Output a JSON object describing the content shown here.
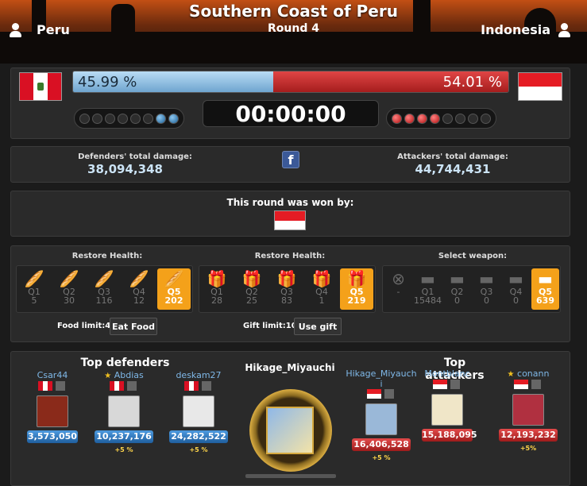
{
  "header": {
    "region": "Southern Coast of Peru",
    "round": "Round 4",
    "defender": "Peru",
    "attacker": "Indonesia"
  },
  "battle": {
    "def_percent": "45.99 %",
    "att_percent": "54.01 %",
    "def_fraction": 0.4599,
    "timer": "00:00:00",
    "def_dots": [
      0,
      0,
      0,
      0,
      0,
      0,
      1,
      1
    ],
    "att_dots": [
      1,
      1,
      1,
      1,
      0,
      0,
      0,
      0
    ]
  },
  "damage": {
    "def_label": "Defenders' total damage:",
    "def_value": "38,094,348",
    "att_label": "Attackers' total damage:",
    "att_value": "44,744,431",
    "facebook_icon": "facebook-icon"
  },
  "round_result": {
    "label": "This round was won by:",
    "winner_flag": "Indonesia"
  },
  "restore": {
    "food_title": "Restore Health:",
    "gift_title": "Restore Health:",
    "weapon_title": "Select weapon:",
    "food": [
      {
        "q": "Q1",
        "n": "5"
      },
      {
        "q": "Q2",
        "n": "30"
      },
      {
        "q": "Q3",
        "n": "116"
      },
      {
        "q": "Q4",
        "n": "12"
      },
      {
        "q": "Q5",
        "n": "202"
      }
    ],
    "gifts": [
      {
        "q": "Q1",
        "n": "28"
      },
      {
        "q": "Q2",
        "n": "25"
      },
      {
        "q": "Q3",
        "n": "83"
      },
      {
        "q": "Q4",
        "n": "1"
      },
      {
        "q": "Q5",
        "n": "219"
      }
    ],
    "weapons": [
      {
        "q": "",
        "n": "-"
      },
      {
        "q": "Q1",
        "n": "15484"
      },
      {
        "q": "Q2",
        "n": "0"
      },
      {
        "q": "Q3",
        "n": "0"
      },
      {
        "q": "Q4",
        "n": "0"
      },
      {
        "q": "Q5",
        "n": "639"
      }
    ],
    "food_limit": "Food limit:4",
    "eat_food": "Eat Food",
    "gift_limit": "Gift limit:10",
    "use_gift": "Use gift"
  },
  "top": {
    "def_title": "Top defenders",
    "att_title": "Top attackers",
    "center_name": "Hikage_Miyauchi",
    "center_damage": "16,406,528",
    "defenders": [
      {
        "name": "Csar44",
        "damage": "3,573,050",
        "star": false,
        "bonus": ""
      },
      {
        "name": "Abdias",
        "damage": "10,237,176",
        "star": true,
        "bonus": "+5 %"
      },
      {
        "name": "deskam27",
        "damage": "24,282,522",
        "star": false,
        "bonus": "+5 %"
      }
    ],
    "attackers": [
      {
        "name": "Hikage_Miyauch i",
        "damage": "16,406,528",
        "star": false,
        "bonus": "+5 %"
      },
      {
        "name": "Montblanc",
        "damage": "15,188,095",
        "star": false,
        "bonus": ""
      },
      {
        "name": "conann",
        "damage": "12,193,232",
        "star": true,
        "bonus": "+5%"
      }
    ]
  }
}
